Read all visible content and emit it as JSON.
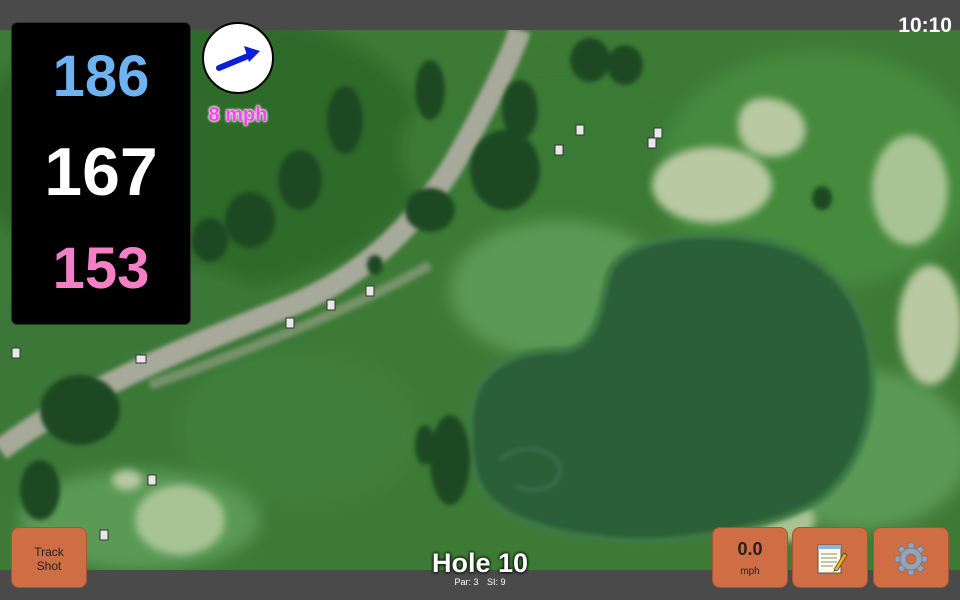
{
  "status": {
    "time": "10:10"
  },
  "distances": {
    "back": "186",
    "center": "167",
    "front": "153",
    "colors": {
      "back": "#6db3f2",
      "center": "#ffffff",
      "front": "#f47fc7"
    }
  },
  "wind": {
    "speed": "8 mph",
    "icon": "wind-arrow-icon",
    "arrow_color": "#0b1fd6"
  },
  "hole": {
    "title": "Hole 10",
    "par": "Par: 3",
    "si": "SI: 9"
  },
  "buttons": {
    "track_shot_line1": "Track",
    "track_shot_line2": "Shot",
    "speed_value": "0.0",
    "speed_unit": "mph",
    "notes_icon": "notepad-icon",
    "settings_icon": "gear-icon",
    "accent": "#cf6e45"
  }
}
